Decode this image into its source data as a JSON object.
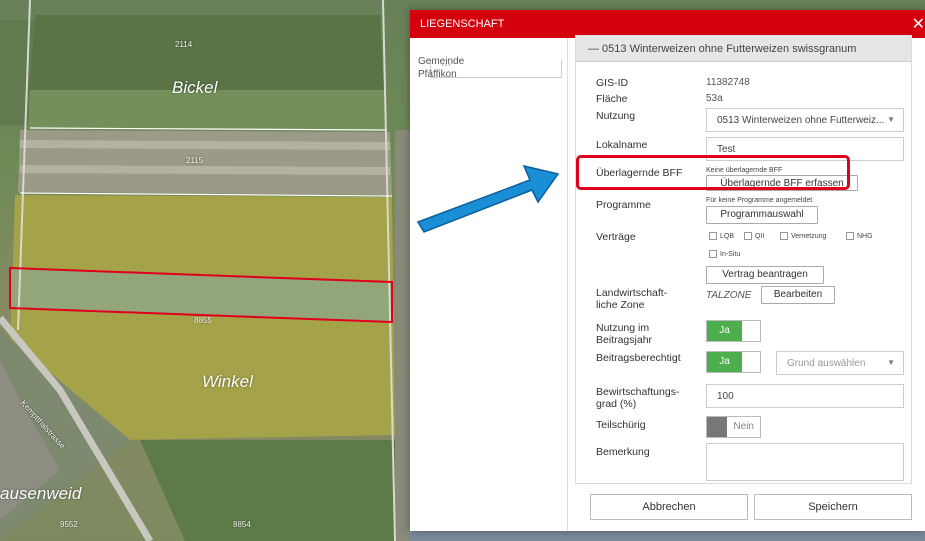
{
  "map": {
    "labels": {
      "bickel": "Bickel",
      "winkel": "Winkel",
      "ausenweid": "ausenweid",
      "street": "Kemptthalstrasse"
    },
    "parcel_numbers": {
      "p2114": "2114",
      "p2115": "2115",
      "p8855": "8855",
      "p9552": "9552",
      "p8854": "8854"
    }
  },
  "panel": {
    "title": "LIEGENSCHAFT",
    "close_icon": "close-icon",
    "left": {
      "gemeinde_label": "Gemeinde",
      "gemeinde_value": "Pfäffikon"
    }
  },
  "form": {
    "title": "— 0513 Winterweizen ohne Futterweizen swissgranum",
    "gis_id_label": "GIS-ID",
    "gis_id_value": "11382748",
    "flaeche_label": "Fläche",
    "flaeche_value": "53a",
    "nutzung_label": "Nutzung",
    "nutzung_value": "0513 Winterweizen ohne Futterweiz...",
    "lokalname_label": "Lokalname",
    "lokalname_value": "Test",
    "bff_label": "Überlagernde BFF",
    "bff_note": "Keine überlagernde BFF",
    "bff_button": "Überlagernde BFF erfassen",
    "programme_label": "Programme",
    "programme_note": "Für keine Programme angemeldet",
    "programme_button": "Programmauswahl",
    "vertraege_label": "Verträge",
    "vertraege_options": [
      "LQB",
      "QII",
      "Vernetzung",
      "NHG",
      "In-Situ"
    ],
    "vertrag_button": "Vertrag beantragen",
    "zone_label_1": "Landwirtschaft-",
    "zone_label_2": "liche Zone",
    "zone_value": "TALZONE",
    "zone_button": "Bearbeiten",
    "nutzung_jahr_label_1": "Nutzung im",
    "nutzung_jahr_label_2": "Beitragsjahr",
    "nutzung_jahr_toggle": "Ja",
    "beitrag_label": "Beitragsberechtigt",
    "beitrag_toggle": "Ja",
    "grund_placeholder": "Grund auswählen",
    "bewirt_label_1": "Bewirtschaftungs-",
    "bewirt_label_2": "grad (%)",
    "bewirt_value": "100",
    "teilschuerig_label": "Teilschürig",
    "teilschuerig_toggle": "Nein",
    "bemerkung_label": "Bemerkung"
  },
  "footer": {
    "cancel_label": "Abbrechen",
    "save_label": "Speichern"
  },
  "colors": {
    "header": "#d5000d",
    "toggle_on": "#4cae4c",
    "highlight": "#e0001b",
    "arrow": "#1a8fd6"
  }
}
